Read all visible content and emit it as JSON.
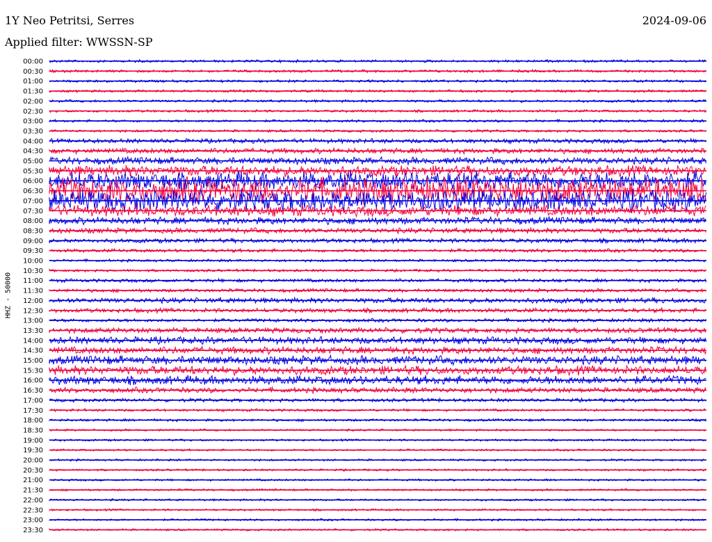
{
  "header": {
    "station": "1Y Neo Petritsi, Serres",
    "filter": "Applied filter: WWSSN-SP",
    "date": "2024-09-06"
  },
  "chart_data": {
    "type": "line",
    "title": "1Y Neo Petritsi, Serres",
    "ylabel": "HHZ - 50000",
    "colors": [
      "#0000e0",
      "#f0003c"
    ],
    "traces": [
      {
        "label": "00:00",
        "amp": 1.5,
        "events": []
      },
      {
        "label": "00:30",
        "amp": 1.5,
        "events": []
      },
      {
        "label": "01:00",
        "amp": 1.5,
        "events": []
      },
      {
        "label": "01:30",
        "amp": 1.5,
        "events": []
      },
      {
        "label": "02:00",
        "amp": 1.5,
        "events": []
      },
      {
        "label": "02:30",
        "amp": 1.5,
        "events": []
      },
      {
        "label": "03:00",
        "amp": 1.5,
        "events": []
      },
      {
        "label": "03:30",
        "amp": 1.5,
        "events": []
      },
      {
        "label": "04:00",
        "amp": 2.5,
        "events": []
      },
      {
        "label": "04:30",
        "amp": 3,
        "events": []
      },
      {
        "label": "05:00",
        "amp": 4,
        "events": []
      },
      {
        "label": "05:30",
        "amp": 6,
        "events": []
      },
      {
        "label": "06:00",
        "amp": 10,
        "events": []
      },
      {
        "label": "06:30",
        "amp": 14,
        "events": []
      },
      {
        "label": "07:00",
        "amp": 12,
        "events": []
      },
      {
        "label": "07:30",
        "amp": 6,
        "events": []
      },
      {
        "label": "08:00",
        "amp": 4,
        "events": []
      },
      {
        "label": "08:30",
        "amp": 3,
        "events": []
      },
      {
        "label": "09:00",
        "amp": 2.5,
        "events": []
      },
      {
        "label": "09:30",
        "amp": 2,
        "events": []
      },
      {
        "label": "10:00",
        "amp": 1.5,
        "events": []
      },
      {
        "label": "10:30",
        "amp": 1.5,
        "events": []
      },
      {
        "label": "11:00",
        "amp": 2,
        "events": []
      },
      {
        "label": "11:30",
        "amp": 2,
        "events": []
      },
      {
        "label": "12:00",
        "amp": 3,
        "events": []
      },
      {
        "label": "12:30",
        "amp": 2.5,
        "events": []
      },
      {
        "label": "13:00",
        "amp": 2,
        "events": []
      },
      {
        "label": "13:30",
        "amp": 3,
        "events": []
      },
      {
        "label": "14:00",
        "amp": 4,
        "events": []
      },
      {
        "label": "14:30",
        "amp": 4,
        "events": []
      },
      {
        "label": "15:00",
        "amp": 5,
        "events": []
      },
      {
        "label": "15:30",
        "amp": 5,
        "events": []
      },
      {
        "label": "16:00",
        "amp": 5,
        "events": []
      },
      {
        "label": "16:30",
        "amp": 3,
        "events": []
      },
      {
        "label": "17:00",
        "amp": 2,
        "events": []
      },
      {
        "label": "17:30",
        "amp": 1.5,
        "events": []
      },
      {
        "label": "18:00",
        "amp": 1.5,
        "events": []
      },
      {
        "label": "18:30",
        "amp": 1.2,
        "events": []
      },
      {
        "label": "19:00",
        "amp": 1.2,
        "events": []
      },
      {
        "label": "19:30",
        "amp": 1.2,
        "events": []
      },
      {
        "label": "20:00",
        "amp": 1.2,
        "events": []
      },
      {
        "label": "20:30",
        "amp": 1.2,
        "events": []
      },
      {
        "label": "21:00",
        "amp": 1.2,
        "events": []
      },
      {
        "label": "21:30",
        "amp": 1.2,
        "events": []
      },
      {
        "label": "22:00",
        "amp": 1.2,
        "events": []
      },
      {
        "label": "22:30",
        "amp": 1.2,
        "events": []
      },
      {
        "label": "23:00",
        "amp": 1.2,
        "events": []
      },
      {
        "label": "23:30",
        "amp": 1.2,
        "events": []
      }
    ]
  }
}
